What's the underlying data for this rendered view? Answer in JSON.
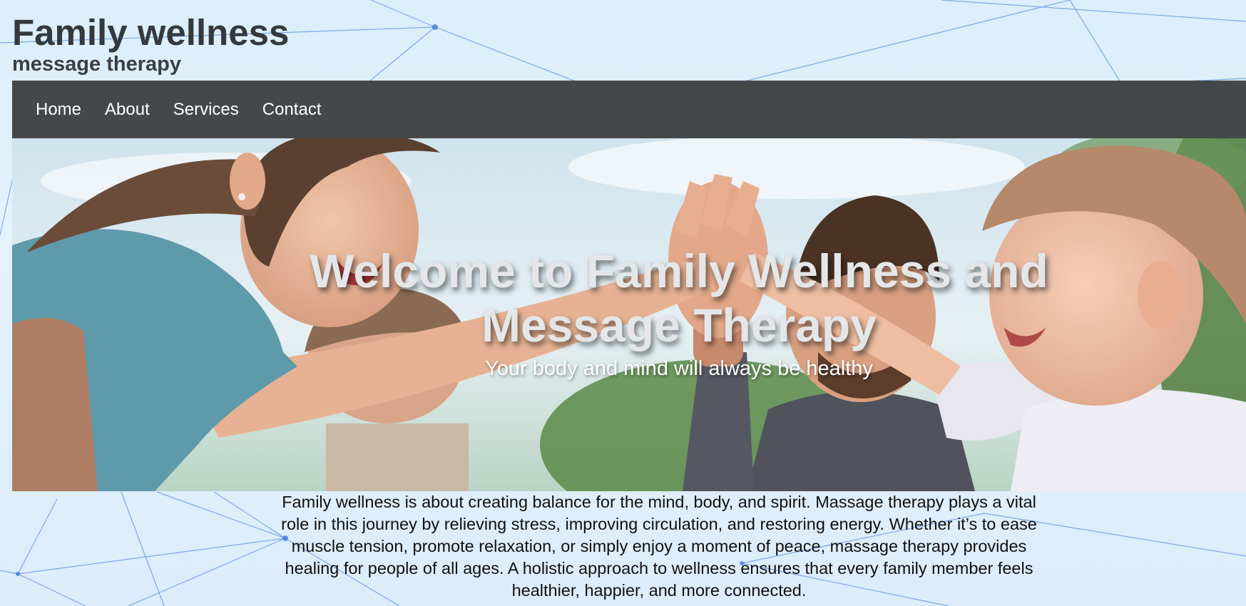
{
  "header": {
    "title": "Family wellness",
    "subtitle": "message therapy"
  },
  "nav": {
    "items": [
      {
        "label": "Home"
      },
      {
        "label": "About"
      },
      {
        "label": "Services"
      },
      {
        "label": "Contact"
      }
    ]
  },
  "hero": {
    "heading": "Welcome to Family Wellness and Message Therapy",
    "tagline": "Your body and mind will always be healthy"
  },
  "intro": {
    "text": "Family wellness is about creating balance for the mind, body, and spirit. Massage therapy plays a vital role in this journey by relieving stress, improving circulation, and restoring energy. Whether it’s to ease muscle tension, promote relaxation, or simply enjoy a moment of peace, massage therapy provides healing for people of all ages. A holistic approach to wellness ensures that every family member feels healthier, happier, and more connected."
  },
  "colors": {
    "navbar_bg": "#45484a",
    "title_text": "#33393d",
    "page_bg": "#dcecfa",
    "network_lines": "#2f6fd6"
  }
}
